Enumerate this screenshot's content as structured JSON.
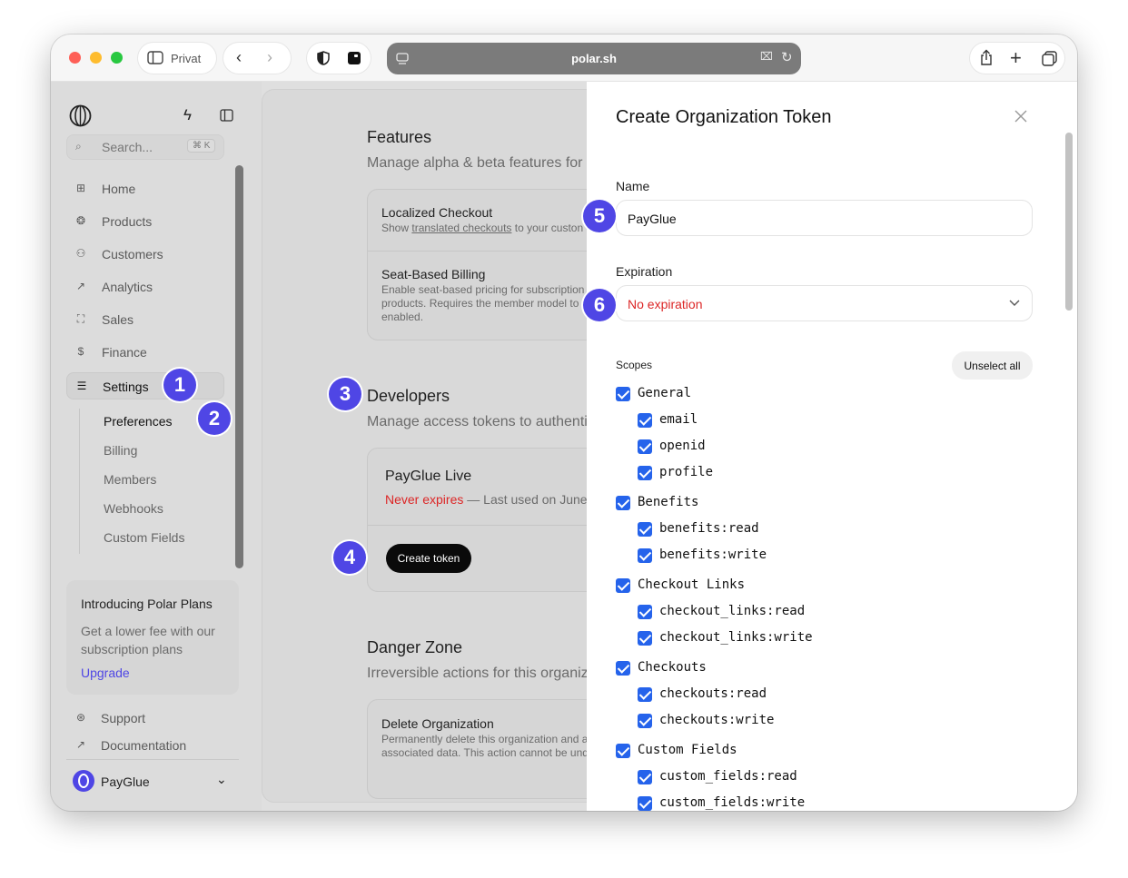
{
  "browser": {
    "profile_label": "Privat",
    "url": "polar.sh"
  },
  "sidebar": {
    "search_placeholder": "Search...",
    "search_shortcut": "⌘ K",
    "items": [
      {
        "label": "Home",
        "icon": "home-icon"
      },
      {
        "label": "Products",
        "icon": "products-icon"
      },
      {
        "label": "Customers",
        "icon": "customers-icon"
      },
      {
        "label": "Analytics",
        "icon": "analytics-icon"
      },
      {
        "label": "Sales",
        "icon": "sales-icon"
      },
      {
        "label": "Finance",
        "icon": "finance-icon"
      },
      {
        "label": "Settings",
        "icon": "settings-icon"
      }
    ],
    "settings_subitems": [
      "Preferences",
      "Billing",
      "Members",
      "Webhooks",
      "Custom Fields"
    ],
    "promo": {
      "title": "Introducing Polar Plans",
      "body": "Get a lower fee with our subscription plans",
      "link": "Upgrade"
    },
    "footer_links": [
      "Support",
      "Documentation"
    ],
    "org_name": "PayGlue"
  },
  "main": {
    "features": {
      "title": "Features",
      "subtitle": "Manage alpha & beta features for y",
      "rows": [
        {
          "title": "Localized Checkout",
          "desc_prefix": "Show ",
          "desc_link": "translated checkouts",
          "desc_suffix": " to your custon"
        },
        {
          "title": "Seat-Based Billing",
          "desc": "Enable seat-based pricing for subscription products. Requires the member model to b enabled."
        }
      ]
    },
    "developers": {
      "title": "Developers",
      "subtitle": "Manage access tokens to authenti",
      "token_name": "PayGlue Live",
      "token_expiry": "Never expires",
      "token_meta": " — Last used on June",
      "create_button": "Create token"
    },
    "danger": {
      "title": "Danger Zone",
      "subtitle": "Irreversible actions for this organiz",
      "row_title": "Delete Organization",
      "row_desc": "Permanently delete this organization and a associated data. This action cannot be und"
    }
  },
  "badges": [
    "1",
    "2",
    "3",
    "4",
    "5",
    "6"
  ],
  "drawer": {
    "title": "Create Organization Token",
    "name_label": "Name",
    "name_value": "PayGlue",
    "expiration_label": "Expiration",
    "expiration_value": "No expiration",
    "scopes_label": "Scopes",
    "unselect_all": "Unselect all",
    "scopes": [
      {
        "label": "General",
        "level": 0,
        "checked": true
      },
      {
        "label": "email",
        "level": 1,
        "checked": true
      },
      {
        "label": "openid",
        "level": 1,
        "checked": true
      },
      {
        "label": "profile",
        "level": 1,
        "checked": true
      },
      {
        "label": "Benefits",
        "level": 0,
        "checked": true
      },
      {
        "label": "benefits:read",
        "level": 1,
        "checked": true
      },
      {
        "label": "benefits:write",
        "level": 1,
        "checked": true
      },
      {
        "label": "Checkout Links",
        "level": 0,
        "checked": true
      },
      {
        "label": "checkout_links:read",
        "level": 1,
        "checked": true
      },
      {
        "label": "checkout_links:write",
        "level": 1,
        "checked": true
      },
      {
        "label": "Checkouts",
        "level": 0,
        "checked": true
      },
      {
        "label": "checkouts:read",
        "level": 1,
        "checked": true
      },
      {
        "label": "checkouts:write",
        "level": 1,
        "checked": true
      },
      {
        "label": "Custom Fields",
        "level": 0,
        "checked": true
      },
      {
        "label": "custom_fields:read",
        "level": 1,
        "checked": true
      },
      {
        "label": "custom_fields:write",
        "level": 1,
        "checked": true
      }
    ]
  },
  "colors": {
    "accent_badge": "#4f46e5",
    "checkbox": "#2563eb",
    "danger_text": "#dc2626",
    "link": "#4f46e5"
  }
}
